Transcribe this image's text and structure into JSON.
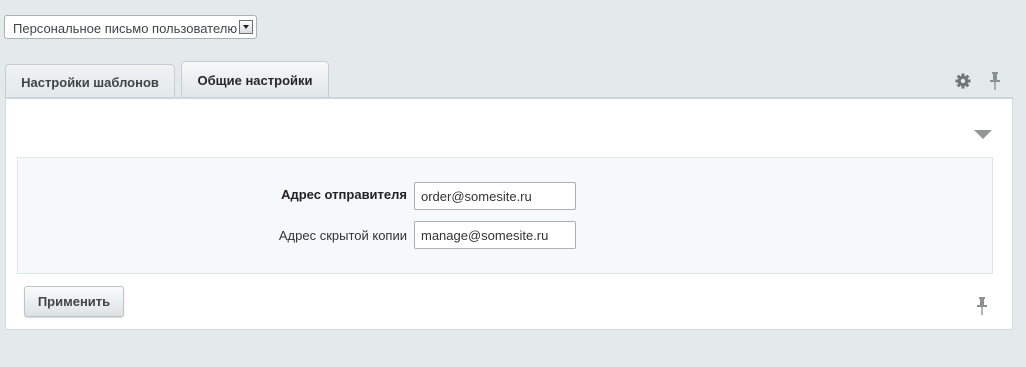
{
  "template_select": {
    "value": "Персональное письмо пользователю"
  },
  "tabs": [
    {
      "label": "Настройки шаблонов",
      "active": false
    },
    {
      "label": "Общие настройки",
      "active": true
    }
  ],
  "icons": {
    "settings": "gear-icon",
    "pin": "pin-icon",
    "collapse": "triangle-down-icon"
  },
  "form": {
    "sender_label": "Адрес отправителя",
    "sender_value": "order@somesite.ru",
    "bcc_label": "Адрес скрытой копии",
    "bcc_value": "manage@somesite.ru"
  },
  "actions": {
    "apply_label": "Применить"
  },
  "colors": {
    "page_background": "#e4e9ec",
    "form_background": "#f5f9f9"
  }
}
